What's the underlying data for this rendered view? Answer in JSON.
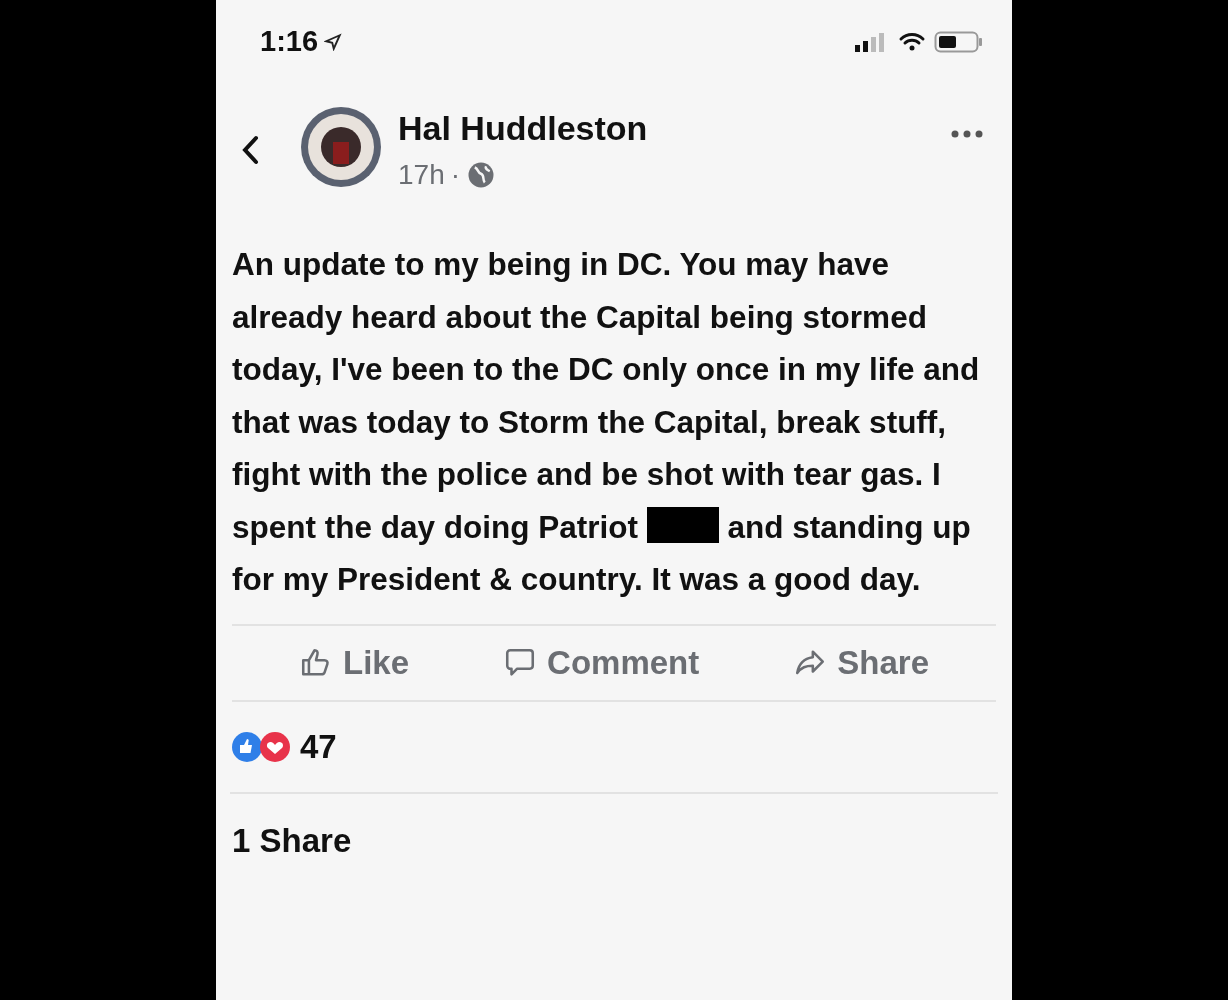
{
  "status_bar": {
    "time": "1:16"
  },
  "post": {
    "author": "Hal Huddleston",
    "time": "17h",
    "separator": "·",
    "text_before_redaction": "An update to my being in DC. You may have already heard about the Capital being stormed today, I've been to the DC only once in my life and that was today to Storm the Capital, break stuff, fight with the police and be shot with tear gas. I spent the day doing Patriot",
    "text_after_redaction": "and standing up for my President & country. It was a good day.",
    "actions": [
      {
        "kind": "like",
        "label": "Like"
      },
      {
        "kind": "comment",
        "label": "Comment"
      },
      {
        "kind": "share",
        "label": "Share"
      }
    ],
    "reaction_count": "47",
    "share_count": "1 Share"
  }
}
